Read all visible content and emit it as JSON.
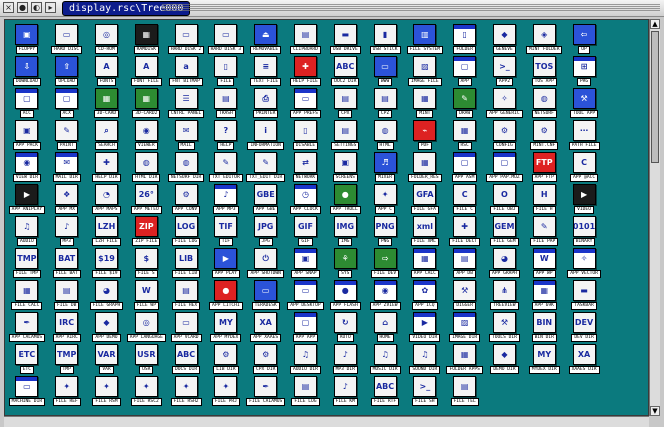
{
  "window": {
    "title": "display.rsc\\Tree000"
  },
  "icons": [
    {
      "label": "FLOPPY",
      "glyph": "▣",
      "style": "blue"
    },
    {
      "label": "HARD DISC",
      "glyph": "▭",
      "style": ""
    },
    {
      "label": "CD-ROM",
      "glyph": "◎",
      "style": ""
    },
    {
      "label": "RAMDISK",
      "glyph": "▦",
      "style": "black"
    },
    {
      "label": "HARD DISK 2",
      "glyph": "▭",
      "style": ""
    },
    {
      "label": "HARD DISK 3",
      "glyph": "▭",
      "style": ""
    },
    {
      "label": "REMOVABLE",
      "glyph": "⏏",
      "style": "blue"
    },
    {
      "label": "CLIPBOARD",
      "glyph": "▤",
      "style": ""
    },
    {
      "label": "USB DRIVE",
      "glyph": "▬",
      "style": ""
    },
    {
      "label": "USB STICK",
      "glyph": "▮",
      "style": ""
    },
    {
      "label": "FILE SYSTEM",
      "glyph": "▥",
      "style": "blue"
    },
    {
      "label": "FOLDER",
      "glyph": "▯",
      "style": "win"
    },
    {
      "label": "GENEVE",
      "glyph": "◆",
      "style": ""
    },
    {
      "label": "MINT FOLDER",
      "glyph": "◈",
      "style": ""
    },
    {
      "label": "UP",
      "glyph": "⇦",
      "style": "blue"
    },
    {
      "label": "",
      "glyph": "",
      "style": "hidden"
    },
    {
      "label": "DOWNLOAD",
      "glyph": "⇩",
      "style": "blue"
    },
    {
      "label": "UPLOAD",
      "glyph": "⇧",
      "style": "blue"
    },
    {
      "label": "FONTS",
      "glyph": "A",
      "style": ""
    },
    {
      "label": "FONT FILE",
      "glyph": "A",
      "style": ""
    },
    {
      "label": "FNT BITMAP",
      "glyph": "a",
      "style": ""
    },
    {
      "label": "FILE",
      "glyph": "▯",
      "style": ""
    },
    {
      "label": "TEXT FILE",
      "glyph": "≡",
      "style": ""
    },
    {
      "label": "HELP FILE",
      "glyph": "✚",
      "style": "red"
    },
    {
      "label": "DOC2 DIR",
      "glyph": "ABC",
      "style": ""
    },
    {
      "label": "WWW",
      "glyph": "▭",
      "style": "blue"
    },
    {
      "label": "IMAGE FILE",
      "glyph": "▨",
      "style": ""
    },
    {
      "label": "APP",
      "glyph": "▢",
      "style": "win"
    },
    {
      "label": "APP2",
      "glyph": ">_",
      "style": ""
    },
    {
      "label": "TOS APP",
      "glyph": "TOS",
      "style": ""
    },
    {
      "label": "PRG",
      "glyph": "⊞",
      "style": "win"
    },
    {
      "label": "",
      "glyph": "",
      "style": "hidden"
    },
    {
      "label": "ACC",
      "glyph": "▢",
      "style": "win"
    },
    {
      "label": "ACX",
      "glyph": "▢",
      "style": "win"
    },
    {
      "label": "3D-CARD",
      "glyph": "▦",
      "style": "green"
    },
    {
      "label": "3D-CARD2",
      "glyph": "▦",
      "style": "green"
    },
    {
      "label": "CNTRL PANEL",
      "glyph": "☰",
      "style": ""
    },
    {
      "label": "TRASH",
      "glyph": "▤",
      "style": ""
    },
    {
      "label": "PRINTER",
      "glyph": "⎙",
      "style": ""
    },
    {
      "label": "APP PREFS",
      "glyph": "▭",
      "style": "win"
    },
    {
      "label": "CPX",
      "glyph": "▤",
      "style": ""
    },
    {
      "label": "CPZ",
      "glyph": "▤",
      "style": ""
    },
    {
      "label": "MINT",
      "glyph": "▦",
      "style": ""
    },
    {
      "label": "DRAW",
      "glyph": "✎",
      "style": "green"
    },
    {
      "label": "APP GENERIC",
      "glyph": "✧",
      "style": ""
    },
    {
      "label": "NETSURF",
      "glyph": "◍",
      "style": ""
    },
    {
      "label": "TOOL APP",
      "glyph": "⚒",
      "style": "blue"
    },
    {
      "label": "",
      "glyph": "",
      "style": "hidden"
    },
    {
      "label": "APP PACK",
      "glyph": "▣",
      "style": ""
    },
    {
      "label": "PAINT",
      "glyph": "✎",
      "style": ""
    },
    {
      "label": "SEARCH",
      "glyph": "⌕",
      "style": ""
    },
    {
      "label": "VIEWER",
      "glyph": "◉",
      "style": ""
    },
    {
      "label": "MAIL",
      "glyph": "✉",
      "style": ""
    },
    {
      "label": "HELP",
      "glyph": "?",
      "style": ""
    },
    {
      "label": "INFORMATION",
      "glyph": "i",
      "style": ""
    },
    {
      "label": "DISABLE",
      "glyph": "▯",
      "style": ""
    },
    {
      "label": "SETTINGS",
      "glyph": "▤",
      "style": ""
    },
    {
      "label": "HTML",
      "glyph": "◍",
      "style": ""
    },
    {
      "label": "PDF",
      "glyph": "⌁",
      "style": "red"
    },
    {
      "label": "RSC",
      "glyph": "▦",
      "style": ""
    },
    {
      "label": "CONFIG",
      "glyph": "⚙",
      "style": ""
    },
    {
      "label": "MINT.CNF",
      "glyph": "⚙",
      "style": ""
    },
    {
      "label": "PATH FILE",
      "glyph": "⋯",
      "style": ""
    },
    {
      "label": "",
      "glyph": "",
      "style": "hidden"
    },
    {
      "label": "VIEW DIR",
      "glyph": "◉",
      "style": "win"
    },
    {
      "label": "MAIL DIR",
      "glyph": "✉",
      "style": "win"
    },
    {
      "label": "HELP DIR",
      "glyph": "✚",
      "style": ""
    },
    {
      "label": "HTML DIR",
      "glyph": "◍",
      "style": ""
    },
    {
      "label": "NETSURF DIR",
      "glyph": "◍",
      "style": ""
    },
    {
      "label": "TXT EDITOR",
      "glyph": "✎",
      "style": ""
    },
    {
      "label": "TXT_EDIT DIR",
      "glyph": "✎",
      "style": ""
    },
    {
      "label": "NETWORK",
      "glyph": "⇄",
      "style": ""
    },
    {
      "label": "SCREENS",
      "glyph": "▣",
      "style": ""
    },
    {
      "label": "MIXER",
      "glyph": "♬",
      "style": "blue"
    },
    {
      "label": "FOLDER_RES",
      "glyph": "▦",
      "style": ""
    },
    {
      "label": "APP ASM",
      "glyph": "▢",
      "style": "win"
    },
    {
      "label": "APP PAP.MUZ",
      "glyph": "▢",
      "style": "win"
    },
    {
      "label": "APP FTP",
      "glyph": "FTP",
      "style": "red"
    },
    {
      "label": "APP @ACC",
      "glyph": "C",
      "style": ""
    },
    {
      "label": "",
      "glyph": "",
      "style": "hidden"
    },
    {
      "label": "APP ANIPLAY",
      "glyph": "▶",
      "style": "black"
    },
    {
      "label": "APP MX",
      "glyph": "❖",
      "style": ""
    },
    {
      "label": "APP MAPS",
      "glyph": "◔",
      "style": ""
    },
    {
      "label": "APP METEO",
      "glyph": "26°",
      "style": ""
    },
    {
      "label": "APP CONV",
      "glyph": "⚙",
      "style": ""
    },
    {
      "label": "APP MP3",
      "glyph": "♪",
      "style": "win"
    },
    {
      "label": "APP GBE",
      "glyph": "GBE",
      "style": ""
    },
    {
      "label": "APP CLOCK",
      "glyph": "◷",
      "style": "win"
    },
    {
      "label": "APP TROLL",
      "glyph": "●",
      "style": "green"
    },
    {
      "label": "APP C",
      "glyph": "✦",
      "style": ""
    },
    {
      "label": "FILE GFA",
      "glyph": "GFA",
      "style": ""
    },
    {
      "label": "FILE C",
      "glyph": "C",
      "style": ""
    },
    {
      "label": "FILE OBJ",
      "glyph": "O",
      "style": ""
    },
    {
      "label": "FILE H",
      "glyph": "H",
      "style": ""
    },
    {
      "label": "VIDEO",
      "glyph": "▶",
      "style": "black"
    },
    {
      "label": "",
      "glyph": "",
      "style": "hidden"
    },
    {
      "label": "AUDIO",
      "glyph": "♫",
      "style": ""
    },
    {
      "label": "MP3",
      "glyph": "♪",
      "style": ""
    },
    {
      "label": "LZH FILE",
      "glyph": "LZH",
      "style": ""
    },
    {
      "label": "ZIP FILE",
      "glyph": "ZIP",
      "style": "red"
    },
    {
      "label": "FILE LOG",
      "glyph": "LOG",
      "style": ""
    },
    {
      "label": "TIF",
      "glyph": "TIF",
      "style": ""
    },
    {
      "label": "JPG",
      "glyph": "JPG",
      "style": ""
    },
    {
      "label": "GIF",
      "glyph": "GIF",
      "style": ""
    },
    {
      "label": "IMG",
      "glyph": "IMG",
      "style": ""
    },
    {
      "label": "PNG",
      "glyph": "PNG",
      "style": ""
    },
    {
      "label": "FILE XML",
      "glyph": "xml",
      "style": ""
    },
    {
      "label": "FILE DECT",
      "glyph": "✚",
      "style": ""
    },
    {
      "label": "FILE GEM",
      "glyph": "GEM",
      "style": ""
    },
    {
      "label": "FILE PAP",
      "glyph": "✎",
      "style": ""
    },
    {
      "label": "BINARY",
      "glyph": "0101",
      "style": ""
    },
    {
      "label": "",
      "glyph": "",
      "style": "hidden"
    },
    {
      "label": "FILE TMP",
      "glyph": "TMP",
      "style": ""
    },
    {
      "label": "FILE BAT",
      "glyph": "BAT",
      "style": ""
    },
    {
      "label": "FILE $19",
      "glyph": "$19",
      "style": ""
    },
    {
      "label": "FILE S",
      "glyph": "$",
      "style": ""
    },
    {
      "label": "FILE LIB",
      "glyph": "LIB",
      "style": ""
    },
    {
      "label": "APP PLAY",
      "glyph": "▶",
      "style": "blue"
    },
    {
      "label": "APP SHUTDWN",
      "glyph": "⏻",
      "style": ""
    },
    {
      "label": "APP SNAP",
      "glyph": "▣",
      "style": "win"
    },
    {
      "label": "SYS",
      "glyph": "⚘",
      "style": "green"
    },
    {
      "label": "FILE DEV",
      "glyph": "⇨",
      "style": "green"
    },
    {
      "label": "APP CALC",
      "glyph": "▦",
      "style": "win"
    },
    {
      "label": "APP DB",
      "glyph": "▤",
      "style": "win"
    },
    {
      "label": "APP GRAPH",
      "glyph": "◕",
      "style": ""
    },
    {
      "label": "APP WP",
      "glyph": "W",
      "style": "win"
    },
    {
      "label": "APP VECTOR",
      "glyph": "✧",
      "style": "win"
    },
    {
      "label": "",
      "glyph": "",
      "style": "hidden"
    },
    {
      "label": "FILE CALC",
      "glyph": "▦",
      "style": ""
    },
    {
      "label": "FILE DB",
      "glyph": "▤",
      "style": ""
    },
    {
      "label": "FILE GRAPH",
      "glyph": "◕",
      "style": ""
    },
    {
      "label": "FILE WP",
      "glyph": "W",
      "style": ""
    },
    {
      "label": "FILE HEX",
      "glyph": "▤",
      "style": ""
    },
    {
      "label": "APP LITCHI",
      "glyph": "●",
      "style": "red"
    },
    {
      "label": "TERADESK",
      "glyph": "▭",
      "style": "blue"
    },
    {
      "label": "APP DESKTOP",
      "glyph": "▭",
      "style": "win"
    },
    {
      "label": "APP FLASH",
      "glyph": "●",
      "style": "win"
    },
    {
      "label": "APP ZVIEW",
      "glyph": "◉",
      "style": "win"
    },
    {
      "label": "APP ICQ",
      "glyph": "✿",
      "style": "win"
    },
    {
      "label": "DIGGER",
      "glyph": "⚒",
      "style": ""
    },
    {
      "label": "TREEVIEW",
      "glyph": "⋔",
      "style": ""
    },
    {
      "label": "APP 69K",
      "glyph": "▦",
      "style": "win"
    },
    {
      "label": "TASKBAR",
      "glyph": "▬",
      "style": ""
    },
    {
      "label": "",
      "glyph": "",
      "style": "hidden"
    },
    {
      "label": "APP CALAMUS",
      "glyph": "✒",
      "style": ""
    },
    {
      "label": "APP AIRC",
      "glyph": "IRC",
      "style": ""
    },
    {
      "label": "APP DEMO",
      "glyph": "◆",
      "style": ""
    },
    {
      "label": "APP LANGUAGE",
      "glyph": "◎",
      "style": ""
    },
    {
      "label": "APP VCARD",
      "glyph": "▭",
      "style": ""
    },
    {
      "label": "APP MYDEX",
      "glyph": "MY",
      "style": ""
    },
    {
      "label": "APP XAAES",
      "glyph": "XA",
      "style": ""
    },
    {
      "label": "APP APP",
      "glyph": "▢",
      "style": "win"
    },
    {
      "label": "AUTO",
      "glyph": "↻",
      "style": ""
    },
    {
      "label": "HOME",
      "glyph": "⌂",
      "style": ""
    },
    {
      "label": "VIDEO DIR",
      "glyph": "▶",
      "style": "win"
    },
    {
      "label": "IMAGE DIR",
      "glyph": "▨",
      "style": "win"
    },
    {
      "label": "TOOLS DIR",
      "glyph": "⚒",
      "style": ""
    },
    {
      "label": "BIN DIR",
      "glyph": "BIN",
      "style": ""
    },
    {
      "label": "DEV DIR",
      "glyph": "DEV",
      "style": ""
    },
    {
      "label": "",
      "glyph": "",
      "style": "hidden"
    },
    {
      "label": "ETC",
      "glyph": "ETC",
      "style": ""
    },
    {
      "label": "TMP",
      "glyph": "TMP",
      "style": ""
    },
    {
      "label": "VAR",
      "glyph": "VAR",
      "style": ""
    },
    {
      "label": "USR",
      "glyph": "USR",
      "style": ""
    },
    {
      "label": "DOCS DIR",
      "glyph": "ABC",
      "style": ""
    },
    {
      "label": "LIB DIR",
      "glyph": "⚙",
      "style": ""
    },
    {
      "label": "CPX DIR",
      "glyph": "⚙",
      "style": ""
    },
    {
      "label": "AUDIO DIR",
      "glyph": "♫",
      "style": ""
    },
    {
      "label": "MP3 DIR",
      "glyph": "♪",
      "style": ""
    },
    {
      "label": "MUSIC DIR",
      "glyph": "♫",
      "style": ""
    },
    {
      "label": "SOUND DIR",
      "glyph": "♫",
      "style": ""
    },
    {
      "label": "FOLDER APPS",
      "glyph": "▦",
      "style": ""
    },
    {
      "label": "DEMO DIR",
      "glyph": "◆",
      "style": ""
    },
    {
      "label": "MYDEX DIR",
      "glyph": "MY",
      "style": ""
    },
    {
      "label": "XAAES DIR",
      "glyph": "XA",
      "style": ""
    },
    {
      "label": "",
      "glyph": "",
      "style": "hidden"
    },
    {
      "label": "MACHINE DIR",
      "glyph": "▭",
      "style": "win"
    },
    {
      "label": "FILE REF",
      "glyph": "✦",
      "style": ""
    },
    {
      "label": "FILE RSM",
      "glyph": "✦",
      "style": ""
    },
    {
      "label": "FILE RSC2",
      "glyph": "✦",
      "style": ""
    },
    {
      "label": "FILE RSH2",
      "glyph": "✦",
      "style": ""
    },
    {
      "label": "FILE PRJ",
      "glyph": "✦",
      "style": ""
    },
    {
      "label": "FILE CALAMUS",
      "glyph": "✒",
      "style": ""
    },
    {
      "label": "FILE LOG",
      "glyph": "▤",
      "style": ""
    },
    {
      "label": "FILE KM",
      "glyph": "♪",
      "style": ""
    },
    {
      "label": "FILE RTF",
      "glyph": "ABC",
      "style": ""
    },
    {
      "label": "FILE SH",
      "glyph": ">_",
      "style": ""
    },
    {
      "label": "FILE TEL",
      "glyph": "▤",
      "style": ""
    }
  ]
}
